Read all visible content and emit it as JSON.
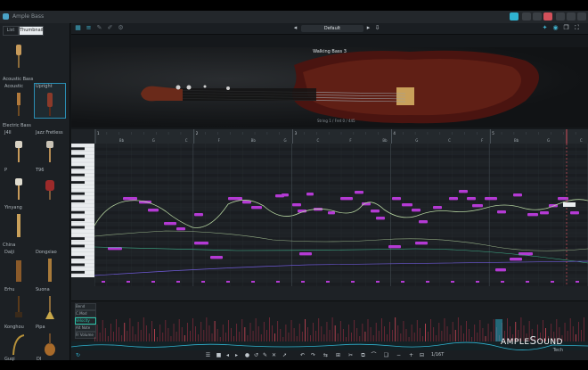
{
  "window": {
    "title": "Ample Bass"
  },
  "sidebar": {
    "tabs": [
      {
        "label": "List"
      },
      {
        "label": "Thumbnail"
      }
    ],
    "sections": [
      {
        "title": "Acoustic Bass",
        "items": [
          {
            "label": "Acoustic"
          },
          {
            "label": "Upright"
          }
        ]
      },
      {
        "title": "Electric Bass",
        "items": [
          {
            "label": "J4II"
          },
          {
            "label": "Jazz Fretless"
          },
          {
            "label": "P"
          },
          {
            "label": "T96"
          },
          {
            "label": "Yinyang"
          }
        ]
      },
      {
        "title": "China",
        "items": [
          {
            "label": "Daiji"
          },
          {
            "label": "Dongxiao"
          },
          {
            "label": "Erhu"
          },
          {
            "label": "Suona"
          },
          {
            "label": "Konghou"
          },
          {
            "label": "Pipa"
          },
          {
            "label": "Guqi"
          },
          {
            "label": "DI"
          }
        ]
      }
    ]
  },
  "toolbar": {
    "preset": "Default"
  },
  "header": {
    "instrument_name": "Walking Bass 3",
    "string_label": "String 1 / Fret 0 / 445"
  },
  "ruler": {
    "bars": [
      "1",
      "2",
      "3",
      "4",
      "5"
    ],
    "chords": [
      "Bb",
      "G",
      "C",
      "F",
      "Bb",
      "G",
      "C",
      "F",
      "Bb",
      "G",
      "C",
      "F",
      "Bb",
      "G",
      "C"
    ]
  },
  "cc_lanes": [
    {
      "label": "Bend",
      "on": false
    },
    {
      "label": "C.Mod",
      "on": false
    },
    {
      "label": "Velocity",
      "on": true
    },
    {
      "label": "Alt Note",
      "on": false
    },
    {
      "label": "Fr Volume",
      "on": false
    }
  ],
  "bottombar": {
    "zoom": "1/16T"
  },
  "brand": {
    "name_part1": "AMPLE",
    "name_letter": "S",
    "name_part2": "OUND",
    "sub": "Tech"
  },
  "colors": {
    "accent": "#2fb3d1",
    "note": "#b43ad4",
    "curve": "#b5d4a0",
    "curve2": "#6e5ad6"
  }
}
